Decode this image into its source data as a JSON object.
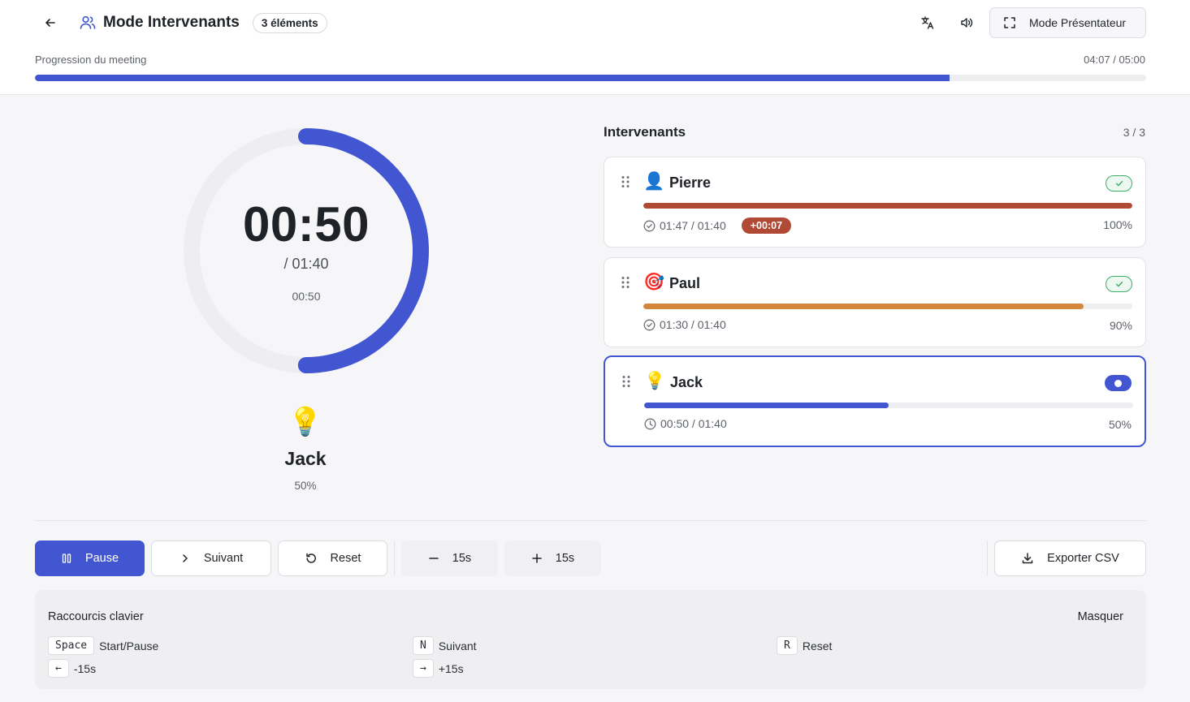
{
  "header": {
    "title": "Mode Intervenants",
    "count_badge": "3 éléments",
    "presenter_label": "Mode Présentateur",
    "progress_label": "Progression du meeting",
    "progress_time": "04:07 / 05:00",
    "progress_fraction": 0.823
  },
  "timer": {
    "main": "00:50",
    "total": "/ 01:40",
    "elapsed": "00:50",
    "ring_fraction": 0.5,
    "speaker_emoji": "💡",
    "speaker_name": "Jack",
    "speaker_pct": "50%"
  },
  "speakers": {
    "title": "Intervenants",
    "count": "3 / 3",
    "items": [
      {
        "emoji": "👤",
        "name": "Pierre",
        "time": "01:47 / 01:40",
        "overtime": "+00:07",
        "pct": "100%",
        "fill": 1.0,
        "color": "#b14a34",
        "status": "done"
      },
      {
        "emoji": "🎯",
        "name": "Paul",
        "time": "01:30 / 01:40",
        "pct": "90%",
        "fill": 0.9,
        "color": "#d4873a",
        "status": "done"
      },
      {
        "emoji": "💡",
        "name": "Jack",
        "time": "00:50 / 01:40",
        "pct": "50%",
        "fill": 0.5,
        "color": "#4356d1",
        "status": "active"
      }
    ]
  },
  "controls": {
    "pause": "Pause",
    "next": "Suivant",
    "reset": "Reset",
    "minus": "15s",
    "plus": "15s",
    "export": "Exporter CSV"
  },
  "shortcuts": {
    "title": "Raccourcis clavier",
    "hide": "Masquer",
    "items": [
      {
        "key": "Space",
        "label": "Start/Pause"
      },
      {
        "key": "N",
        "label": "Suivant"
      },
      {
        "key": "R",
        "label": "Reset"
      },
      {
        "key": "←",
        "label": "-15s"
      },
      {
        "key": "→",
        "label": "+15s"
      }
    ]
  },
  "colors": {
    "accent": "#4356d1",
    "overtime": "#b14a34",
    "warning": "#d4873a",
    "success": "#3fae6a"
  }
}
